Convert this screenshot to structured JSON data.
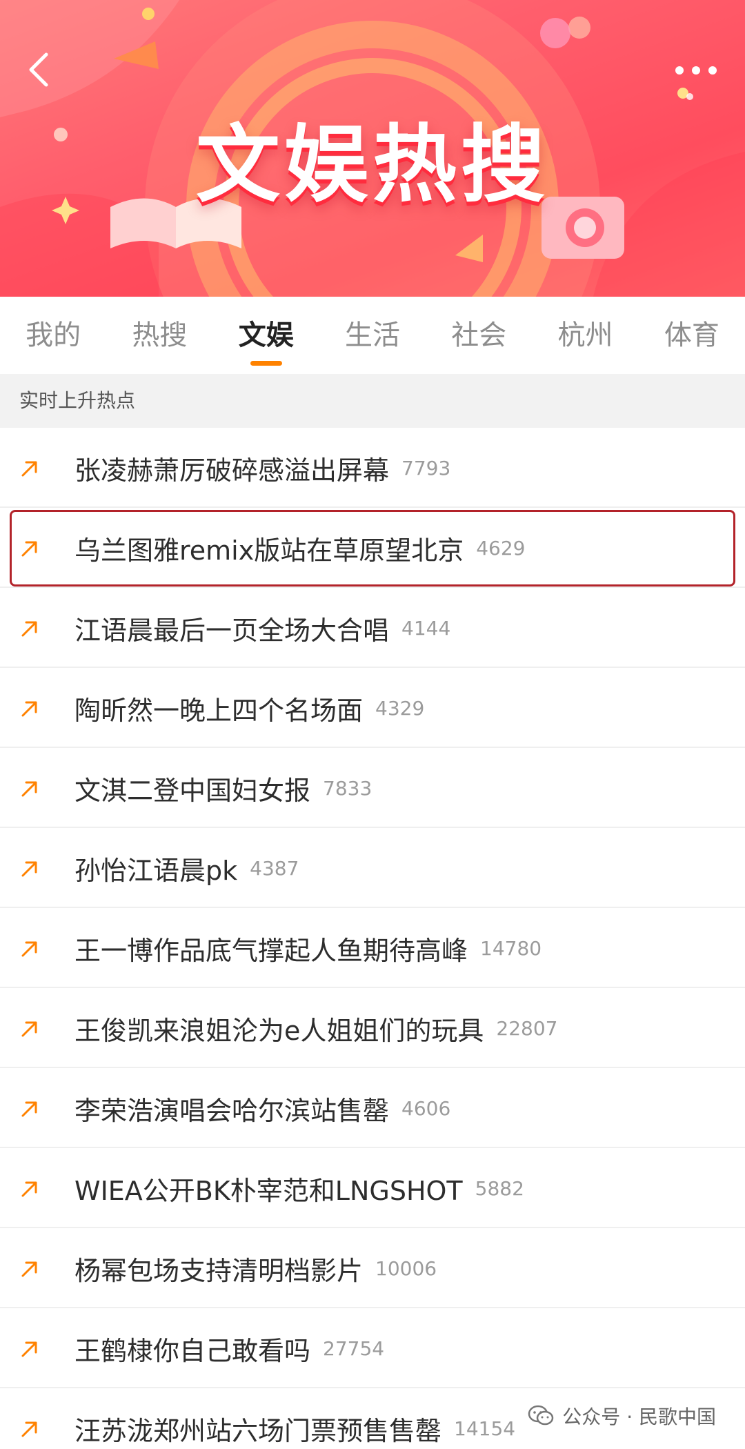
{
  "header": {
    "title": "文娱热搜"
  },
  "tabs": [
    {
      "label": "我的",
      "active": false
    },
    {
      "label": "热搜",
      "active": false
    },
    {
      "label": "文娱",
      "active": true
    },
    {
      "label": "生活",
      "active": false
    },
    {
      "label": "社会",
      "active": false
    },
    {
      "label": "杭州",
      "active": false
    },
    {
      "label": "体育",
      "active": false
    }
  ],
  "section": {
    "label": "实时上升热点"
  },
  "items": [
    {
      "title": "张凌赫萧厉破碎感溢出屏幕",
      "count": "7793"
    },
    {
      "title": "乌兰图雅remix版站在草原望北京",
      "count": "4629",
      "highlighted": true
    },
    {
      "title": "江语晨最后一页全场大合唱",
      "count": "4144"
    },
    {
      "title": "陶昕然一晚上四个名场面",
      "count": "4329"
    },
    {
      "title": "文淇二登中国妇女报",
      "count": "7833"
    },
    {
      "title": "孙怡江语晨pk",
      "count": "4387"
    },
    {
      "title": "王一博作品底气撑起人鱼期待高峰",
      "count": "14780"
    },
    {
      "title": "王俊凯来浪姐沦为e人姐姐们的玩具",
      "count": "22807"
    },
    {
      "title": "李荣浩演唱会哈尔滨站售罄",
      "count": "4606"
    },
    {
      "title": "WIEA公开BK朴宰范和LNGSHOT",
      "count": "5882"
    },
    {
      "title": "杨幂包场支持清明档影片",
      "count": "10006"
    },
    {
      "title": "王鹤棣你自己敢看吗",
      "count": "27754"
    },
    {
      "title": "汪苏泷郑州站六场门票预售售罄",
      "count": "14154"
    }
  ],
  "watermark": {
    "text": "公众号 · 民歌中国"
  },
  "colors": {
    "accent": "#ff8200",
    "banner": "#ff5f6d",
    "highlight_border": "#b3232a"
  },
  "icons": {
    "back": "chevron-left-icon",
    "more": "more-dots-icon",
    "rising": "arrow-up-right-icon"
  }
}
